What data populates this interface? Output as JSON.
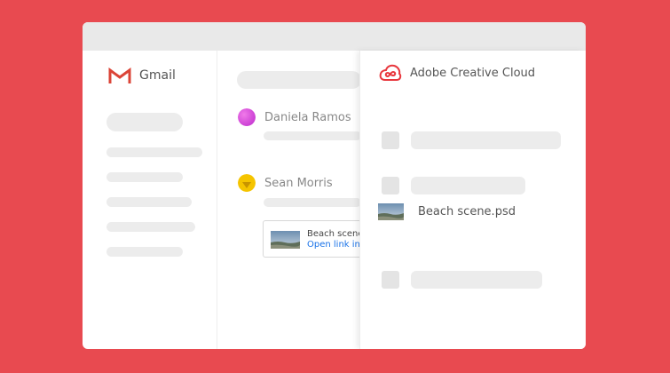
{
  "colors": {
    "background": "#e84a50",
    "window": "#ffffff",
    "titlebar": "#e9e9e9",
    "skeleton": "#ececec",
    "gmail_red": "#db4437",
    "cc_red": "#e8373d",
    "link_blue": "#1a73e8",
    "avatar_pink": "#e84ad8",
    "avatar_yellow": "#f5c400"
  },
  "gmail": {
    "logo_icon": "gmail-m-icon",
    "label": "Gmail"
  },
  "inbox": {
    "emails": [
      {
        "sender": "Daniela Ramos",
        "avatar_icon": "avatar-pink-icon"
      },
      {
        "sender": "Sean Morris",
        "avatar_icon": "avatar-yellow-icon"
      }
    ],
    "attachment": {
      "name": "Beach scene.",
      "link": "Open link in A"
    }
  },
  "creative_cloud": {
    "logo_icon": "creative-cloud-icon",
    "label": "Adobe Creative Cloud",
    "file_name": "Beach scene.psd"
  }
}
